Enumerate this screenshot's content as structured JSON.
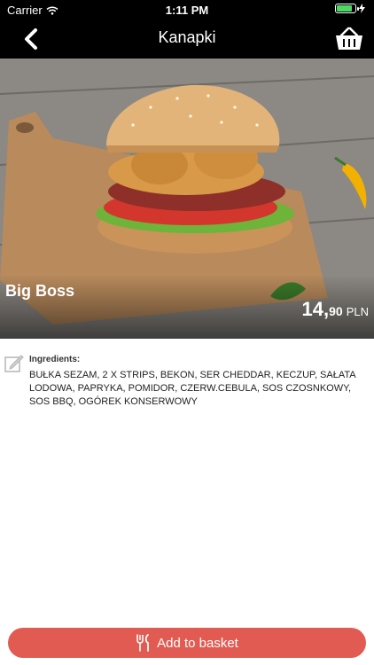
{
  "status_bar": {
    "carrier": "Carrier",
    "time": "1:11 PM",
    "battery_level": 0.85
  },
  "nav": {
    "title": "Kanapki"
  },
  "product": {
    "name": "Big Boss",
    "price_main": "14,",
    "price_decimal": "90",
    "currency": "PLN"
  },
  "ingredients": {
    "label": "Ingredients:",
    "text": "BUŁKA SEZAM, 2 X STRIPS, BEKON, SER CHEDDAR, KECZUP, SAŁATA LODOWA, PAPRYKA, POMIDOR, CZERW.CEBULA, SOS CZOSNKOWY, SOS BBQ, OGÓREK KONSERWOWY"
  },
  "actions": {
    "add_to_basket": "Add to basket"
  },
  "colors": {
    "accent": "#e25b52",
    "bar": "#000000",
    "battery": "#4cd964"
  }
}
